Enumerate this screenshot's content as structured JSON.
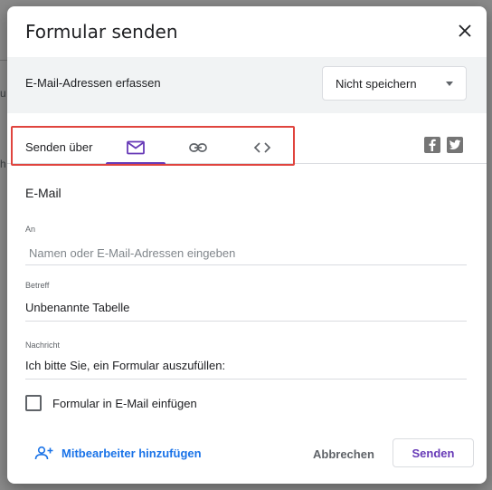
{
  "dialog": {
    "title": "Formular senden",
    "collect_emails_label": "E-Mail-Adressen erfassen",
    "collect_emails_select": "Nicht speichern"
  },
  "send_via": {
    "label": "Senden über",
    "tabs": [
      {
        "icon": "email-icon",
        "active": true
      },
      {
        "icon": "link-icon",
        "active": false
      },
      {
        "icon": "embed-code-icon",
        "active": false
      }
    ],
    "social": [
      "facebook-icon",
      "twitter-icon"
    ]
  },
  "email_form": {
    "section_title": "E-Mail",
    "to_label": "An",
    "to_placeholder": "Namen oder E-Mail-Adressen eingeben",
    "subject_label": "Betreff",
    "subject_value": "Unbenannte Tabelle",
    "message_label": "Nachricht",
    "message_value": "Ich bitte Sie, ein Formular auszufüllen:",
    "include_form_label": "Formular in E-Mail einfügen",
    "include_form_checked": false
  },
  "footer": {
    "add_collaborators": "Mitbearbeiter hinzufügen",
    "cancel": "Abbrechen",
    "send": "Senden"
  },
  "colors": {
    "accent": "#673ab7",
    "link": "#1a73e8",
    "highlight": "#e0443e"
  }
}
